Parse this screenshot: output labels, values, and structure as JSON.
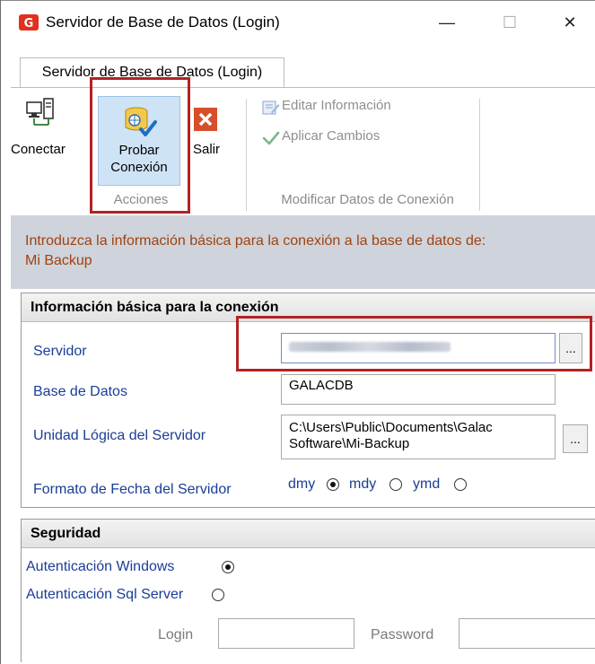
{
  "window": {
    "title": "Servidor de Base de Datos (Login)",
    "minimize_glyph": "—",
    "maximize_glyph": "☐",
    "close_glyph": "✕"
  },
  "ribbon": {
    "tab_label": "Servidor de Base de Datos (Login)",
    "buttons": {
      "conectar": "Conectar",
      "probar_line1": "Probar",
      "probar_line2": "Conexión",
      "salir": "Salir",
      "editar": "Editar Información",
      "aplicar": "Aplicar Cambios"
    },
    "groups": {
      "acciones": "Acciones",
      "modificar": "Modificar Datos de Conexión"
    }
  },
  "info": {
    "line1": "Introduzca la información básica para la conexión a la base de datos de:",
    "line2": "Mi Backup"
  },
  "basic_panel": {
    "header": "Información básica para la conexión",
    "servidor_label": "Servidor",
    "servidor_value": "",
    "ellipsis": "...",
    "base_label": "Base de Datos",
    "base_value": "GALACDB",
    "unidad_label": "Unidad Lógica del Servidor",
    "unidad_value_line1": "C:\\Users\\Public\\Documents\\Galac",
    "unidad_value_line2": "Software\\Mi-Backup",
    "formato_label": "Formato de Fecha del Servidor",
    "formato_options": [
      "dmy",
      "mdy",
      "ymd"
    ],
    "formato_selected": "dmy"
  },
  "security_panel": {
    "header": "Seguridad",
    "auth_windows": "Autenticación Windows",
    "auth_sql": "Autenticación Sql Server",
    "auth_selected": "windows",
    "login_label": "Login",
    "password_label": "Password",
    "login_value": "",
    "password_value": ""
  },
  "colors": {
    "accent_red": "#b22222",
    "info_text": "#a0420f",
    "label_blue": "#1a3d96",
    "info_band": "#cfd3db"
  }
}
